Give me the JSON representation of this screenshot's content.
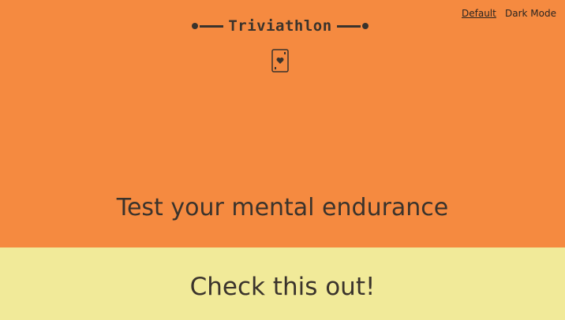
{
  "header": {
    "brand_title": "Triviathlon",
    "mode_default_label": "Default",
    "mode_dark_label": "Dark Mode",
    "logo_icon": "playing-card-heart-icon"
  },
  "hero": {
    "tagline": "Test your mental endurance"
  },
  "band": {
    "cta": "Check this out!"
  },
  "colors": {
    "hero_background": "#f58a40",
    "band_background": "#f1ea99",
    "text_dark": "#3a332c"
  }
}
